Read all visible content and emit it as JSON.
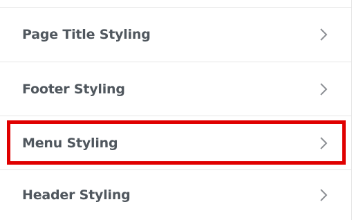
{
  "menu": {
    "items": [
      {
        "label": "Page Title Styling",
        "icon": "chevron-right-icon"
      },
      {
        "label": "Footer Styling",
        "icon": "chevron-right-icon"
      },
      {
        "label": "Menu Styling",
        "icon": "chevron-right-icon",
        "highlighted": true
      },
      {
        "label": "Header Styling",
        "icon": "chevron-right-icon"
      }
    ]
  },
  "colors": {
    "text": "#50575e",
    "divider": "#e6e6e6",
    "chevron": "#8c8f94",
    "highlight": "#e00000"
  }
}
